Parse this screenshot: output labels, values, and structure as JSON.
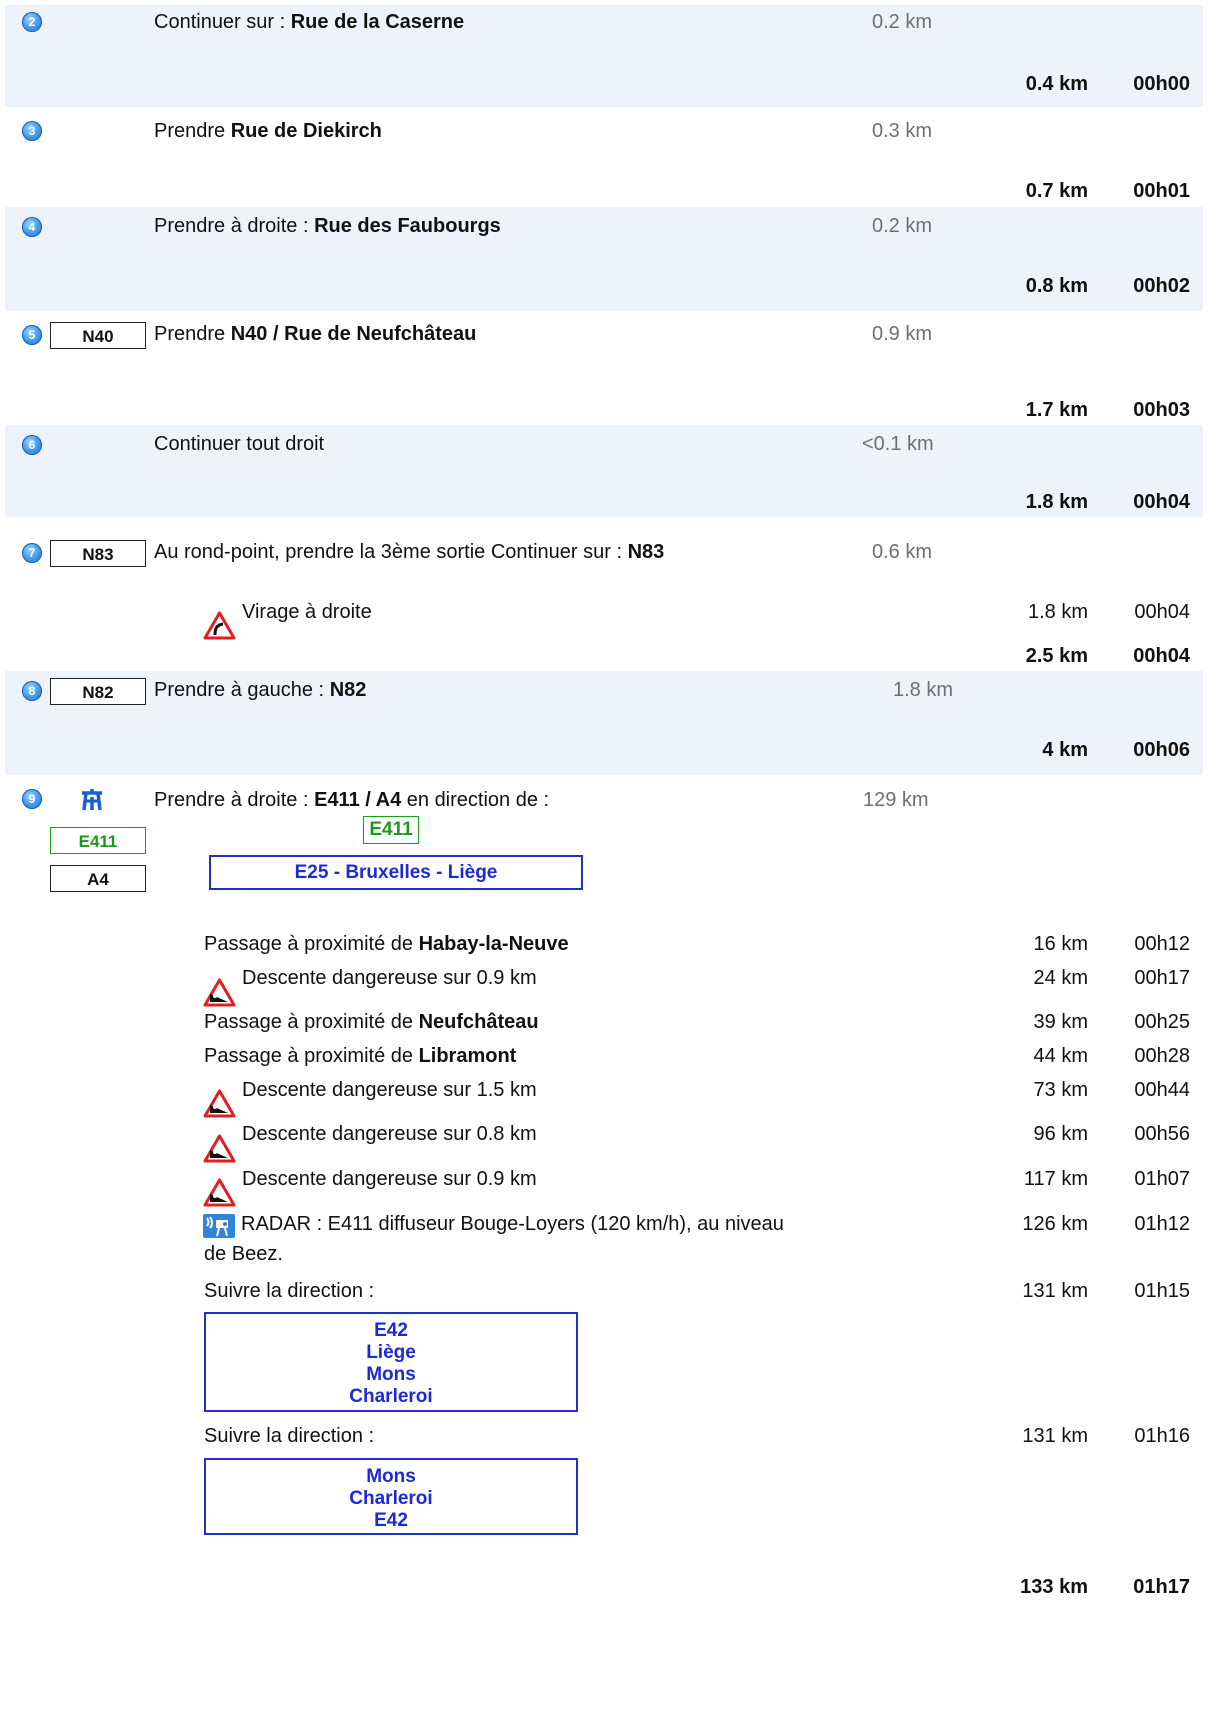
{
  "steps": {
    "s2": {
      "num": "2",
      "pre": "Continuer sur : ",
      "road": "Rue de la Caserne",
      "dist": "0.2 km",
      "total_km": "0.4 km",
      "total_time": "00h00"
    },
    "s3": {
      "num": "3",
      "pre": "Prendre ",
      "road": "Rue de Diekirch",
      "dist": "0.3 km",
      "total_km": "0.7 km",
      "total_time": "00h01"
    },
    "s4": {
      "num": "4",
      "pre": "Prendre à droite : ",
      "road": "Rue des Faubourgs",
      "dist": "0.2 km",
      "total_km": "0.8 km",
      "total_time": "00h02"
    },
    "s5": {
      "num": "5",
      "badge": "N40",
      "pre": "Prendre ",
      "road": "N40 / Rue de Neufchâteau",
      "dist": "0.9 km",
      "total_km": "1.7 km",
      "total_time": "00h03"
    },
    "s6": {
      "num": "6",
      "text": "Continuer tout droit",
      "dist": "<0.1 km",
      "total_km": "1.8 km",
      "total_time": "00h04"
    },
    "s7": {
      "num": "7",
      "badge": "N83",
      "pre": "Au rond-point, prendre la 3ème sortie Continuer sur : ",
      "road": "N83",
      "dist": "0.6 km",
      "alert_text": "Virage à droite",
      "alert_icon": "curve-right-warning-icon",
      "alert_km": "1.8 km",
      "alert_time": "00h04",
      "total_km": "2.5 km",
      "total_time": "00h04"
    },
    "s8": {
      "num": "8",
      "badge": "N82",
      "pre": "Prendre à gauche : ",
      "road": "N82",
      "dist": "1.8 km",
      "total_km": "4 km",
      "total_time": "00h06"
    },
    "s9": {
      "num": "9",
      "motorway_icon": "motorway-icon",
      "badge1": "E411",
      "badge2": "A4",
      "pre": "Prendre à droite : ",
      "road": "E411 / A4",
      "post": " en direction de :",
      "dist": "129 km",
      "sign_e411": "E411",
      "sign_dir": "E25 - Bruxelles - Liège",
      "passes": [
        {
          "pre": "Passage à proximité de ",
          "bold": "Habay-la-Neuve",
          "km": "16 km",
          "time": "00h12"
        },
        {
          "icon": "steep-descent-icon",
          "text": "Descente dangereuse sur 0.9 km",
          "km": "24 km",
          "time": "00h17"
        },
        {
          "pre": "Passage à proximité de ",
          "bold": "Neufchâteau",
          "km": "39 km",
          "time": "00h25"
        },
        {
          "pre": "Passage à proximité de ",
          "bold": "Libramont",
          "km": "44 km",
          "time": "00h28"
        },
        {
          "icon": "steep-descent-icon",
          "text": "Descente dangereuse sur 1.5 km",
          "km": "73 km",
          "time": "00h44"
        },
        {
          "icon": "steep-descent-icon",
          "text": "Descente dangereuse sur 0.8 km",
          "km": "96 km",
          "time": "00h56"
        },
        {
          "icon": "steep-descent-icon",
          "text": "Descente dangereuse sur 0.9 km",
          "km": "117 km",
          "time": "01h07"
        }
      ],
      "radar_icon": "speed-radar-icon",
      "radar_line1": "RADAR : E411 diffuseur Bouge-Loyers (120 km/h), au niveau",
      "radar_line2": "de Beez.",
      "radar_km": "126 km",
      "radar_time": "01h12",
      "follow1": {
        "text": "Suivre la direction :",
        "km": "131 km",
        "time": "01h15",
        "lines": [
          "E42",
          "Liège",
          "Mons",
          "Charleroi"
        ]
      },
      "follow2": {
        "text": "Suivre la direction :",
        "km": "131 km",
        "time": "01h16",
        "lines": [
          "Mons",
          "Charleroi",
          "E42"
        ]
      },
      "total_km": "133 km",
      "total_time": "01h17"
    }
  },
  "colors": {
    "band": "#eef3fb",
    "sign_blue": "#1c2ad6",
    "road_green": "#1a9a1a"
  }
}
